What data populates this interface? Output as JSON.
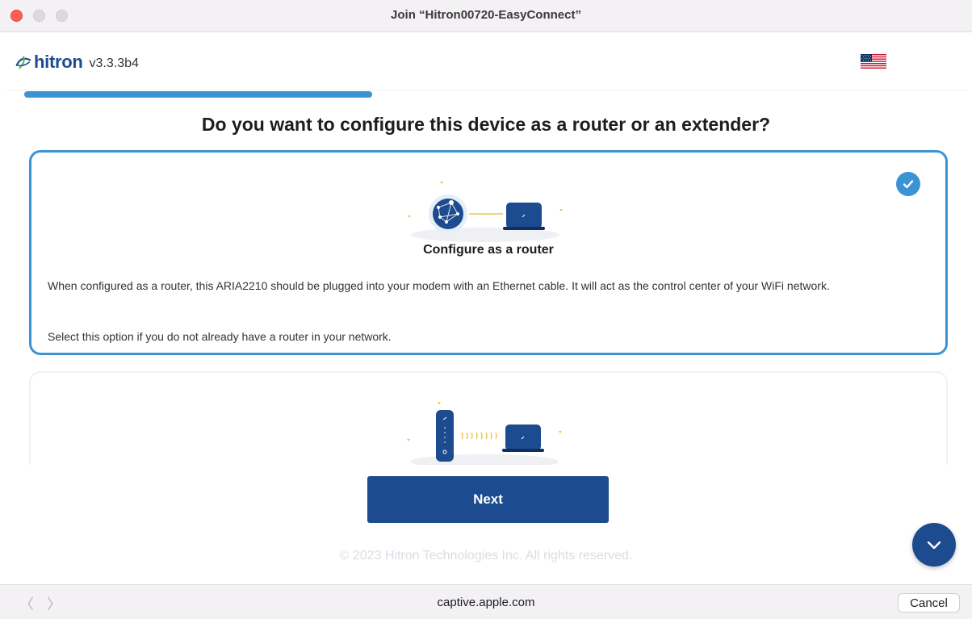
{
  "window": {
    "title": "Join “Hitron00720-EasyConnect”"
  },
  "header": {
    "logo_text": "hitron",
    "version": "v3.3.3b4",
    "language_flag": "us-flag-icon"
  },
  "progress": {
    "fraction": 0.375
  },
  "main": {
    "question": "Do you want to configure this device as a router or an extender?",
    "options": [
      {
        "title": "Configure as a router",
        "description": "When configured as a router, this ARIA2210 should be plugged into your modem with an Ethernet cable. It will act as the control center of your WiFi network.",
        "note": "Select this option if you do not already have a router in your network.",
        "selected": true
      },
      {
        "selected": false
      }
    ],
    "next_label": "Next",
    "copyright": "© 2023 Hitron Technologies Inc. All rights reserved."
  },
  "bottom_bar": {
    "url": "captive.apple.com",
    "cancel_label": "Cancel",
    "back_icon": "chevron-left-icon",
    "forward_icon": "chevron-right-icon"
  },
  "colors": {
    "brand": "#1d4b8f",
    "accent": "#3a93d3",
    "close": "#ff5f57"
  }
}
